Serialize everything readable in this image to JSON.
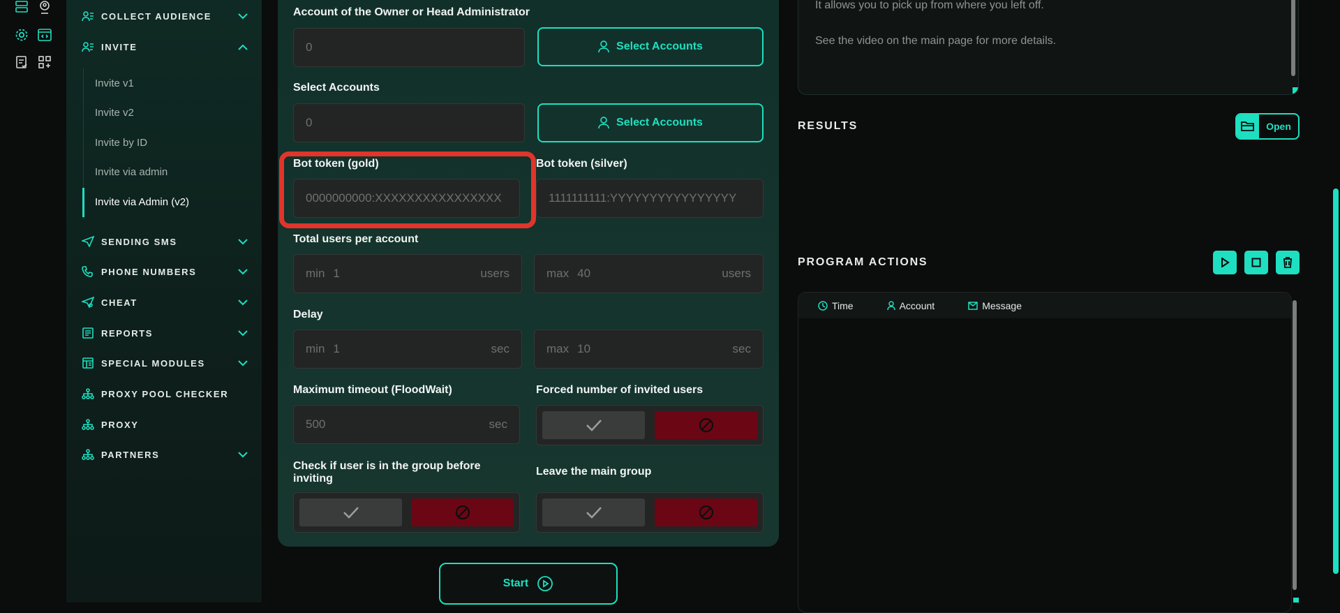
{
  "sidebar": {
    "sections": [
      {
        "label": "COLLECT AUDIENCE",
        "icon": "users-list-icon",
        "state": "collapsed"
      },
      {
        "label": "INVITE",
        "icon": "users-list-icon",
        "state": "expanded"
      },
      {
        "label": "SENDING SMS",
        "icon": "send-icon",
        "state": "collapsed"
      },
      {
        "label": "PHONE NUMBERS",
        "icon": "phone-icon",
        "state": "collapsed"
      },
      {
        "label": "CHEAT",
        "icon": "send-icon",
        "state": "collapsed"
      },
      {
        "label": "REPORTS",
        "icon": "report-icon",
        "state": "collapsed"
      },
      {
        "label": "SPECIAL MODULES",
        "icon": "modules-icon",
        "state": "collapsed"
      },
      {
        "label": "PROXY POOL CHECKER",
        "icon": "network-icon",
        "state": "none"
      },
      {
        "label": "PROXY",
        "icon": "network-icon",
        "state": "none"
      },
      {
        "label": "PARTNERS",
        "icon": "network-icon",
        "state": "collapsed"
      }
    ],
    "invite_items": [
      "Invite v1",
      "Invite v2",
      "Invite by ID",
      "Invite via admin",
      "Invite via Admin (v2)"
    ],
    "active_item": "Invite via Admin (v2)"
  },
  "form": {
    "owner": {
      "label": "Account of the Owner or Head Administrator",
      "value": "0",
      "button": "Select Accounts"
    },
    "accounts": {
      "label": "Select Accounts",
      "value": "0",
      "button": "Select Accounts"
    },
    "bot_gold": {
      "label": "Bot token (gold)",
      "placeholder": "0000000000:XXXXXXXXXXXXXXXX"
    },
    "bot_silver": {
      "label": "Bot token (silver)",
      "placeholder": "1111111111:YYYYYYYYYYYYYYYY"
    },
    "users_per_account": {
      "label": "Total users per account",
      "min_prefix": "min",
      "min": "1",
      "max_prefix": "max",
      "max": "40",
      "unit": "users"
    },
    "delay": {
      "label": "Delay",
      "min_prefix": "min",
      "min": "1",
      "max_prefix": "max",
      "max": "10",
      "unit": "sec"
    },
    "floodwait": {
      "label": "Maximum timeout (FloodWait)",
      "value": "500",
      "unit": "sec"
    },
    "forced_invited": {
      "label": "Forced number of invited users"
    },
    "check_in_group": {
      "label": "Check if user is in the group before inviting"
    },
    "leave_main": {
      "label": "Leave the main group"
    },
    "start_label": "Start"
  },
  "right": {
    "hint_lines": [
      "It allows you to pick up from where you left off.",
      "See the video on the main page for more details."
    ],
    "results_title": "RESULTS",
    "open_label": "Open",
    "actions_title": "PROGRAM ACTIONS",
    "columns": [
      "Time",
      "Account",
      "Message"
    ]
  },
  "colors": {
    "accent": "#1ee0c0",
    "danger": "#6b0615",
    "highlight": "#e0352b"
  }
}
